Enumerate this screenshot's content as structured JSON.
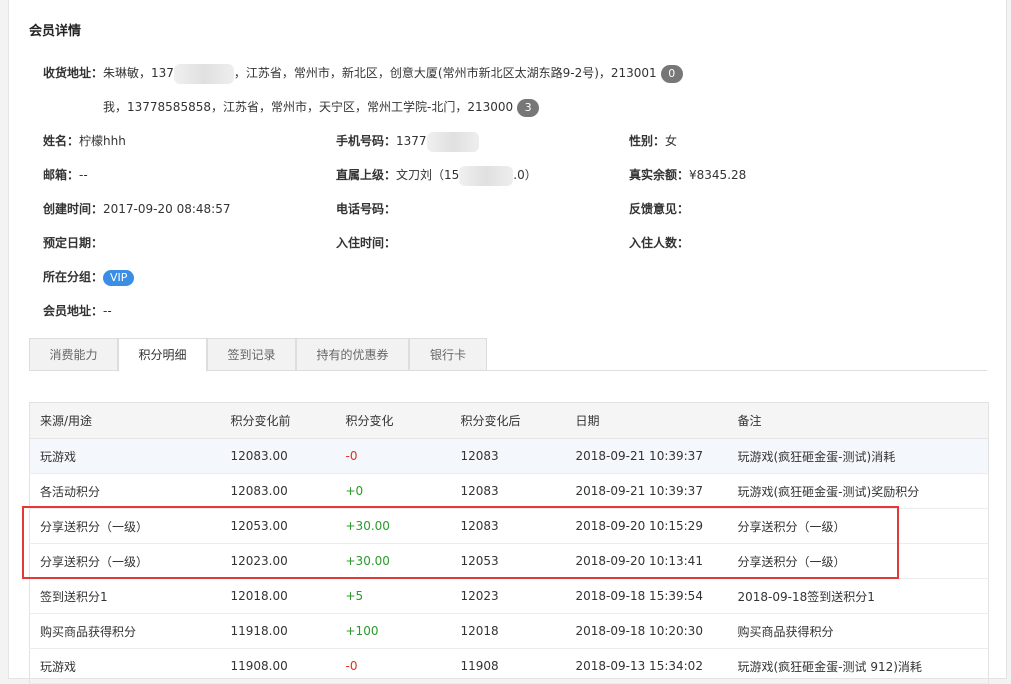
{
  "page_title": "会员详情",
  "addresses": [
    {
      "label": "收货地址：",
      "text_pre": "朱琳敏，137",
      "text_post": "，江苏省，常州市，新北区，创意大厦(常州市新北区太湖东路9-2号)，213001",
      "count": "0"
    },
    {
      "text": "我，13778585858，江苏省，常州市，天宁区，常州工学院-北门，213000",
      "count": "3"
    }
  ],
  "fields": {
    "name": {
      "label": "姓名：",
      "value": "柠檬hhh"
    },
    "phone": {
      "label": "手机号码：",
      "value": "1377"
    },
    "gender": {
      "label": "性别：",
      "value": "女"
    },
    "email": {
      "label": "邮箱：",
      "value": "--"
    },
    "superior": {
      "label": "直属上级：",
      "value_pre": "文刀刘（15",
      "value_post": ".0）"
    },
    "balance": {
      "label": "真实余额：",
      "value": "¥8345.28"
    },
    "created": {
      "label": "创建时间：",
      "value": "2017-09-20 08:48:57"
    },
    "telephone": {
      "label": "电话号码：",
      "value": ""
    },
    "feedback": {
      "label": "反馈意见：",
      "value": ""
    },
    "reserve_date": {
      "label": "预定日期：",
      "value": ""
    },
    "checkin_time": {
      "label": "入住时间：",
      "value": ""
    },
    "guests": {
      "label": "入住人数：",
      "value": ""
    },
    "group": {
      "label": "所在分组：",
      "value": "VIP"
    },
    "member_address": {
      "label": "会员地址：",
      "value": "--"
    }
  },
  "tabs": [
    "消费能力",
    "积分明细",
    "签到记录",
    "持有的优惠券",
    "银行卡"
  ],
  "active_tab": "积分明细",
  "table": {
    "headers": [
      "来源/用途",
      "积分变化前",
      "积分变化",
      "积分变化后",
      "日期",
      "备注"
    ],
    "rows": [
      [
        "玩游戏",
        "12083.00",
        "-0",
        "12083",
        "2018-09-21 10:39:37",
        "玩游戏(疯狂砸金蛋-测试)消耗"
      ],
      [
        "各活动积分",
        "12083.00",
        "+0",
        "12083",
        "2018-09-21 10:39:37",
        "玩游戏(疯狂砸金蛋-测试)奖励积分"
      ],
      [
        "分享送积分（一级）",
        "12053.00",
        "+30.00",
        "12083",
        "2018-09-20 10:15:29",
        "分享送积分（一级）"
      ],
      [
        "分享送积分（一级）",
        "12023.00",
        "+30.00",
        "12053",
        "2018-09-20 10:13:41",
        "分享送积分（一级）"
      ],
      [
        "签到送积分1",
        "12018.00",
        "+5",
        "12023",
        "2018-09-18 15:39:54",
        "2018-09-18签到送积分1"
      ],
      [
        "购买商品获得积分",
        "11918.00",
        "+100",
        "12018",
        "2018-09-18 10:20:30",
        "购买商品获得积分"
      ],
      [
        "玩游戏",
        "11908.00",
        "-0",
        "11908",
        "2018-09-13 15:34:02",
        "玩游戏(疯狂砸金蛋-测试 912)消耗"
      ]
    ]
  },
  "colors": {
    "accent": "#3a8ee6",
    "negative": "#e0301e",
    "positive": "#2a9a2a",
    "highlight": "#e53935"
  }
}
